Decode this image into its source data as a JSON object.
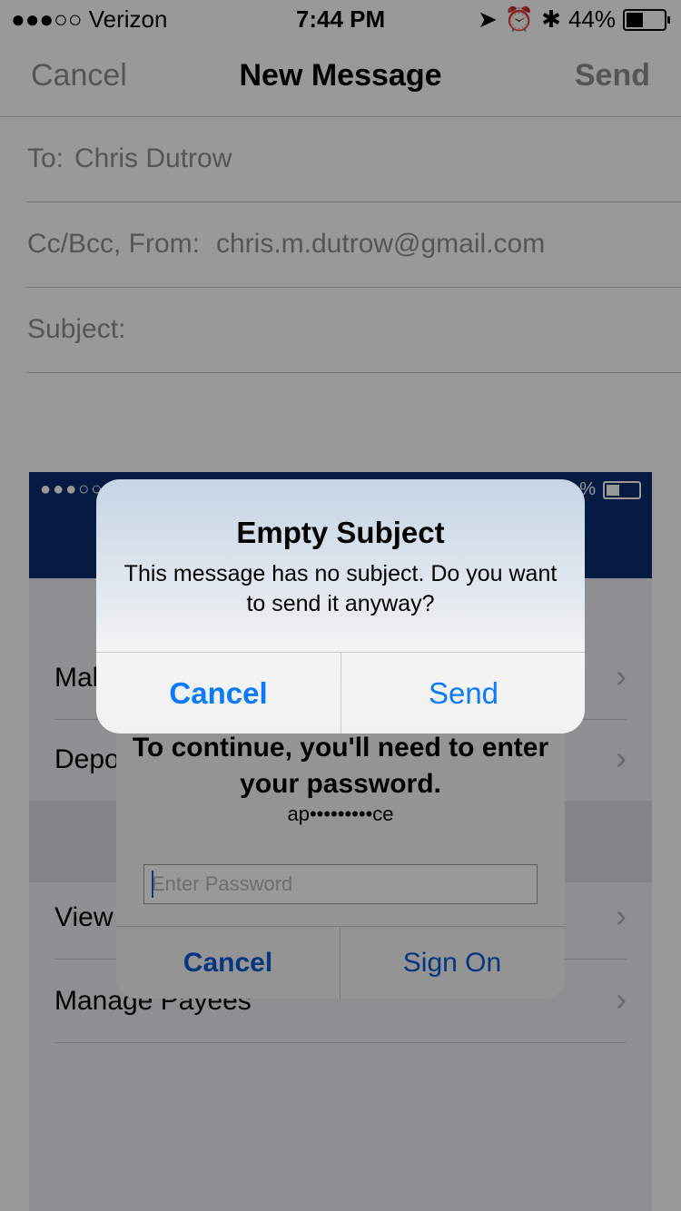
{
  "status_bar": {
    "carrier": "●●●○○ Verizon",
    "time": "7:44 PM",
    "battery_text": "44%"
  },
  "compose": {
    "cancel_label": "Cancel",
    "title": "New Message",
    "send_label": "Send",
    "to_label": "To:",
    "to_value": "Chris Dutrow",
    "ccbcc_label": "Cc/Bcc, From:",
    "from_value": "chris.m.dutrow@gmail.com",
    "subject_label": "Subject:"
  },
  "attachment": {
    "status_left": "●●●○○",
    "status_right": "%",
    "rows": [
      {
        "label": "Mak"
      },
      {
        "label": "Depo"
      },
      {
        "label": "View"
      },
      {
        "label": "Manage Payees"
      }
    ],
    "password_sheet": {
      "message": "To continue, you'll need to enter your password.",
      "masked_user": "ap•••••••••ce",
      "password_placeholder": "Enter Password",
      "cancel_label": "Cancel",
      "sign_on_label": "Sign On"
    }
  },
  "alert": {
    "title": "Empty Subject",
    "message": "This message has no subject. Do you want to send it anyway?",
    "cancel_label": "Cancel",
    "send_label": "Send"
  }
}
